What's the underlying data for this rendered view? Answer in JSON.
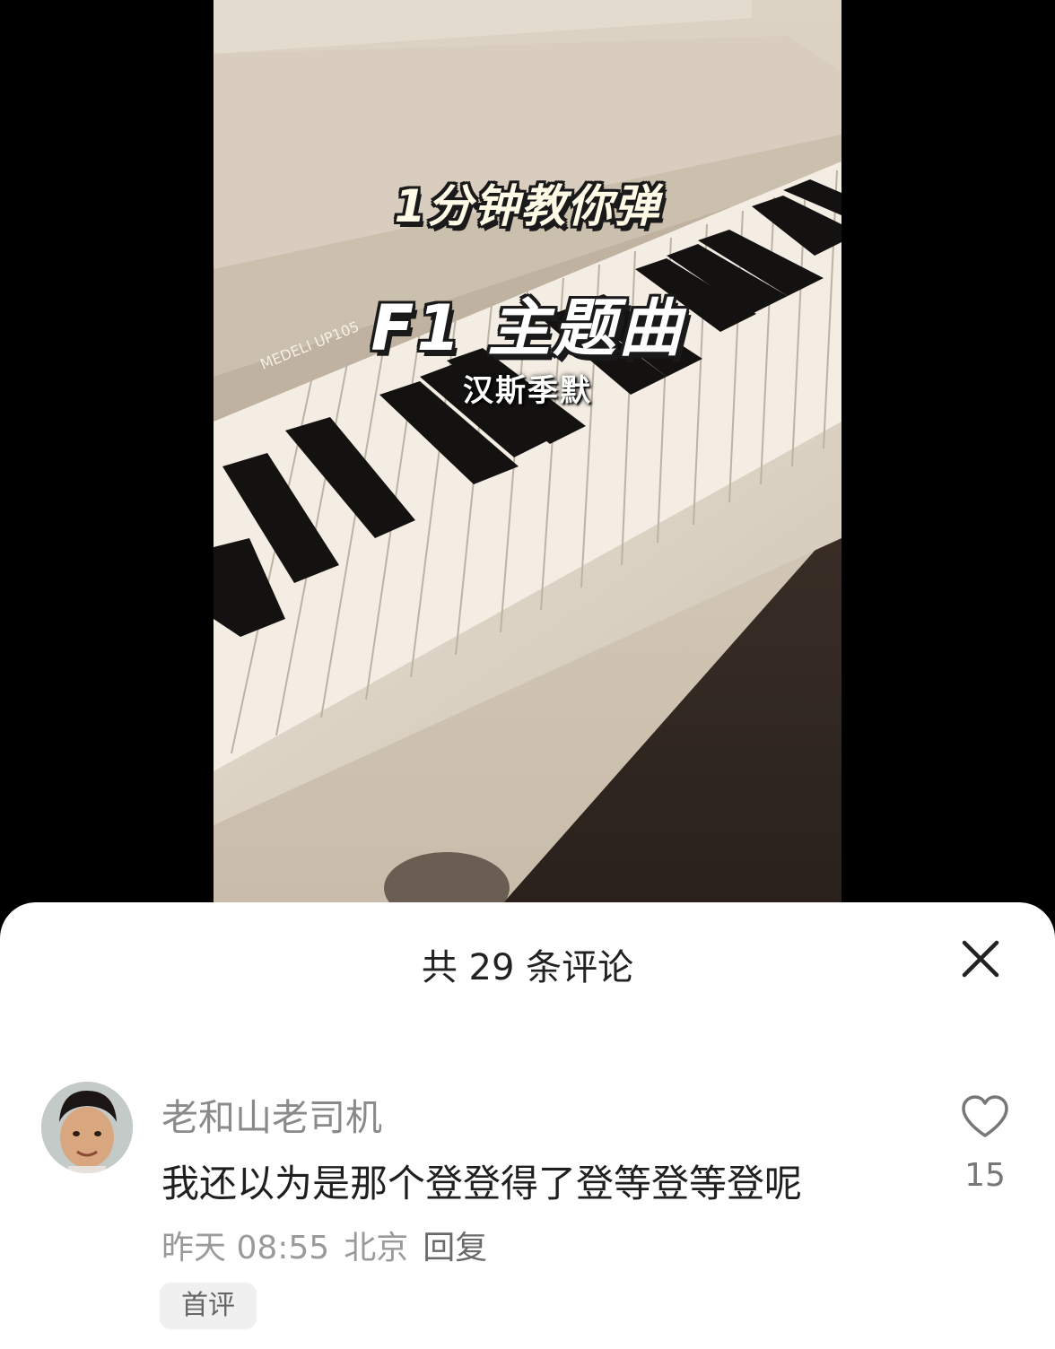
{
  "video": {
    "overlay_line1": "1分钟教你弹",
    "overlay_line2": "F1 主题曲",
    "overlay_line3": "汉斯季默",
    "piano_brand": "MEDELI UP105"
  },
  "comments_panel": {
    "title": "共 29 条评论",
    "close_icon": "close-icon",
    "comments": [
      {
        "username": "老和山老司机",
        "text": "我还以为是那个登登得了登等登等登呢",
        "time": "昨天 08:55",
        "location": "北京",
        "reply_label": "回复",
        "badge": "首评",
        "like_icon": "heart-icon",
        "like_count": "15"
      }
    ]
  },
  "colors": {
    "sheet_background": "#ffffff",
    "title_text": "#222222",
    "muted_text": "#8a8a8a",
    "badge_background": "#f0f0f0"
  }
}
